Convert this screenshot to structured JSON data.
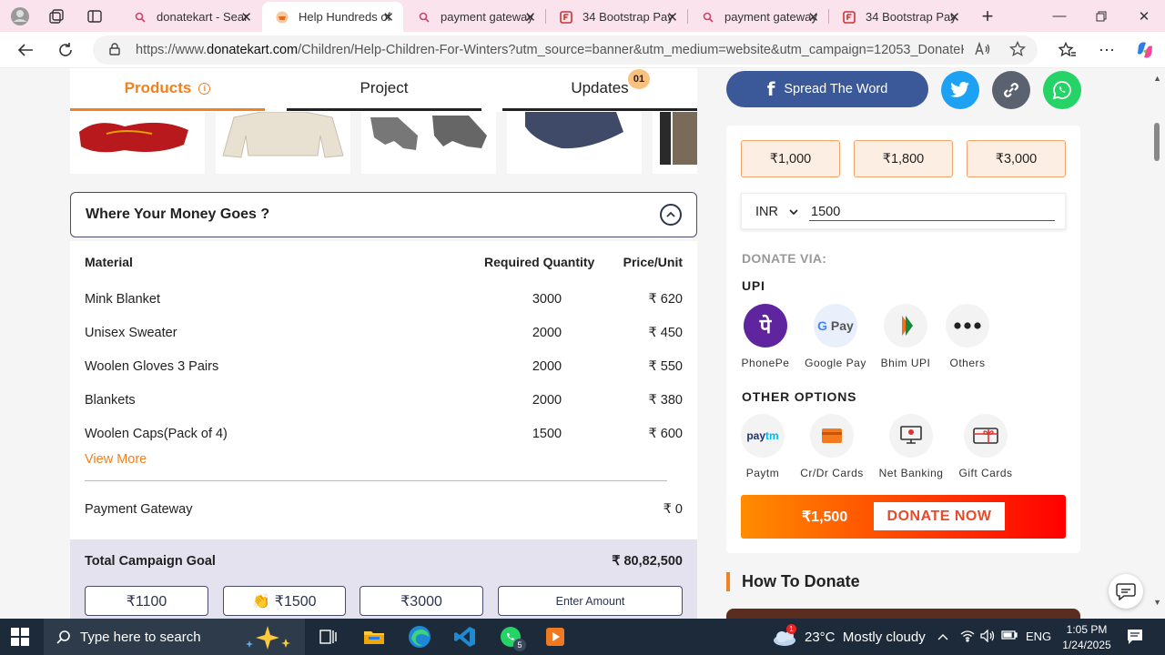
{
  "browser": {
    "tabs": [
      {
        "title": "donatekart - Sear",
        "icon": "search-icon"
      },
      {
        "title": "Help Hundreds of",
        "icon": "donatekart-favicon",
        "active": true
      },
      {
        "title": "payment gateway",
        "icon": "search-icon"
      },
      {
        "title": "34 Bootstrap Pay",
        "icon": "frontendfreak-favicon"
      },
      {
        "title": "payment gateway",
        "icon": "search-icon"
      },
      {
        "title": "34 Bootstrap Pay",
        "icon": "frontendfreak-favicon"
      }
    ],
    "url_prefix": "https://www.",
    "url_domain": "donatekart.com",
    "url_rest": "/Children/Help-Children-For-Winters?utm_source=banner&utm_medium=website&utm_campaign=12053_DonateK..."
  },
  "page": {
    "tabs": [
      {
        "label": "Products",
        "active": true
      },
      {
        "label": "Project"
      },
      {
        "label": "Updates",
        "badge": "01"
      }
    ],
    "money_title": "Where Your Money Goes ?",
    "table": {
      "headers": {
        "material": "Material",
        "quantity": "Required Quantity",
        "price": "Price/Unit"
      },
      "rows": [
        {
          "material": "Mink Blanket",
          "quantity": "3000",
          "price": "₹ 620"
        },
        {
          "material": "Unisex Sweater",
          "quantity": "2000",
          "price": "₹ 450"
        },
        {
          "material": "Woolen Gloves 3 Pairs",
          "quantity": "2000",
          "price": "₹ 550"
        },
        {
          "material": "Blankets",
          "quantity": "2000",
          "price": "₹ 380"
        },
        {
          "material": "Woolen Caps(Pack of 4)",
          "quantity": "1500",
          "price": "₹ 600"
        }
      ],
      "view_more": "View More",
      "payment_gateway_label": "Payment Gateway",
      "payment_gateway_value": "₹ 0"
    },
    "total": {
      "label": "Total Campaign Goal",
      "value": "₹ 80,82,500"
    },
    "amount_buttons": [
      "₹1100",
      "👏 ₹1500",
      "₹3000",
      "Enter Amount"
    ],
    "share": {
      "label": "Spread The Word"
    },
    "donate": {
      "presets": [
        "₹1,000",
        "₹1,800",
        "₹3,000"
      ],
      "currency": "INR",
      "amount": "1500",
      "via_label": "DONATE VIA:",
      "upi_label": "UPI",
      "upi_options": [
        "PhonePe",
        "Google Pay",
        "Bhim UPI",
        "Others"
      ],
      "other_label": "OTHER OPTIONS",
      "other_options": [
        "Paytm",
        "Cr/Dr Cards",
        "Net Banking",
        "Gift Cards"
      ],
      "cta_amount": "₹1,500",
      "cta_label": "DONATE NOW"
    },
    "how_to_donate": "How To Donate"
  },
  "taskbar": {
    "search_placeholder": "Type here to search",
    "weather": "23°C  Mostly cloudy",
    "weather_alert": "1",
    "whatsapp_badge": "5",
    "lang": "ENG",
    "time": "1:05 PM",
    "date": "1/24/2025"
  },
  "colors": {
    "accent_orange": "#f2811d",
    "facebook": "#3b5998",
    "twitter": "#1da1f2",
    "whatsapp": "#25d366",
    "phonepe": "#5f259f"
  }
}
